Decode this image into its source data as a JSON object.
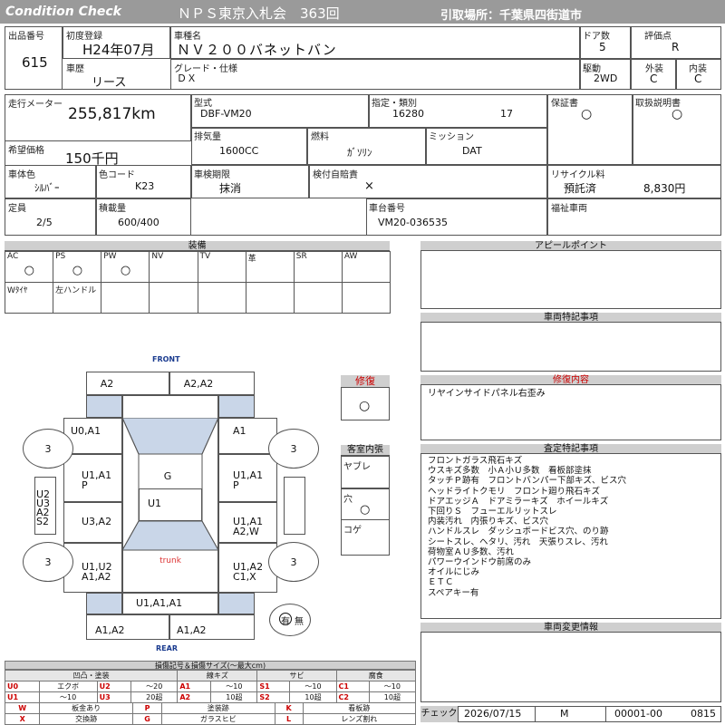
{
  "banner": {
    "title": "Condition Check",
    "auction": "ＮＰＳ東京入札会　363回",
    "pickup": "引取場所：千葉県四街道市"
  },
  "basic": {
    "lot_label": "出品番号",
    "lot": "615",
    "first_reg_label": "初度登録",
    "first_reg": "H24年07月",
    "name_label": "車種名",
    "name": "ＮＶ２００バネットバン",
    "door_label": "ドア数",
    "door": "5",
    "score_label": "評価点",
    "score": "R",
    "history_label": "車歴",
    "history": "リース",
    "grade_label": "グレード・仕様",
    "grade": "ＤＸ",
    "drive_label": "駆動",
    "drive": "2WD",
    "ext_label": "外装",
    "ext": "C",
    "int_label": "内装",
    "int": "C"
  },
  "spec": {
    "mileage_label": "走行メーター",
    "mileage": "255,817km",
    "model_label": "型式",
    "model": "DBF-VM20",
    "designation_label": "指定・類別",
    "designation": "16280",
    "category": "17",
    "warranty_label": "保証書",
    "warranty": "○",
    "manual_label": "取扱説明書",
    "manual": "○",
    "price_label": "希望価格",
    "price": "150千円",
    "displacement_label": "排気量",
    "displacement": "1600CC",
    "fuel_label": "燃料",
    "fuel": "ｶﾞｿﾘﾝ",
    "mission_label": "ミッション",
    "mission": "DAT",
    "color_label": "車体色",
    "color": "ｼﾙﾊﾞｰ",
    "color_code_label": "色コード",
    "color_code": "K23",
    "inspection_label": "車検期限",
    "inspection": "抹消",
    "insurance_label": "検付自賠責",
    "insurance": "×",
    "recycle_label": "リサイクル料",
    "recycle_status": "預託済",
    "recycle_fee": "8,830円",
    "capacity_label": "定員",
    "capacity": "2/5",
    "load_label": "積載量",
    "load": "600/400",
    "chassis_label": "車台番号",
    "chassis": "VM20-036535",
    "welfare_label": "福祉車両"
  },
  "equipment": {
    "title": "装備",
    "row1": [
      {
        "label": "AC",
        "mark": "○"
      },
      {
        "label": "PS",
        "mark": "○"
      },
      {
        "label": "PW",
        "mark": "○"
      },
      {
        "label": "NV",
        "mark": ""
      },
      {
        "label": "TV",
        "mark": ""
      },
      {
        "label": "革",
        "mark": ""
      },
      {
        "label": "SR",
        "mark": ""
      },
      {
        "label": "AW",
        "mark": ""
      }
    ],
    "row2": [
      {
        "label": "Wﾀｲﾔ"
      },
      {
        "label": "左ハンドル"
      },
      {
        "label": ""
      },
      {
        "label": ""
      },
      {
        "label": ""
      },
      {
        "label": ""
      },
      {
        "label": ""
      },
      {
        "label": ""
      }
    ]
  },
  "appeal": {
    "title": "アピールポイント"
  },
  "special": {
    "title": "車両特記事項"
  },
  "repair_box": {
    "title": "修復",
    "mark": "○"
  },
  "repair_content": {
    "title": "修復内容",
    "text": "リヤインサイドパネル右歪み"
  },
  "interior": {
    "title": "客室内張",
    "items": [
      {
        "label": "ヤブレ",
        "mark": ""
      },
      {
        "label": "穴",
        "mark": "○"
      },
      {
        "label": "コゲ",
        "mark": ""
      }
    ]
  },
  "inspector": {
    "title": "査定特記事項",
    "lines": [
      "フロントガラス飛石キズ",
      "ウスキズ多数　小Ａ小Ｕ多数　看板部塗抹",
      "タッチＰ跡有　フロントバンパー下部キズ、ビス穴",
      "ヘッドライトクモリ　フロント廻り飛石キズ",
      "ドアエッジＡ　ドアミラーキズ　ホイールキズ",
      "下回りＳ　フューエルリットスレ",
      "内装汚れ　内張りキズ、ビス穴",
      "ハンドルスレ　ダッシュボードビス穴、のり跡",
      "シートスレ、ヘタリ、汚れ　天張りスレ、汚れ",
      "荷物室ＡＵ多数、汚れ",
      "パワーウインドウ前席のみ",
      "オイルにじみ",
      "ＥＴＣ",
      "スペアキー有"
    ]
  },
  "changes": {
    "title": "車両変更情報"
  },
  "footer": {
    "check_label": "チェック",
    "date": "2026/07/15",
    "inspector_code": "M",
    "sheet_no": "00001-00",
    "lot": "0815"
  },
  "diagram": {
    "front": "FRONT",
    "rear": "REAR",
    "trunk": "trunk",
    "tire": "3",
    "cells": {
      "front_left": "A2",
      "front_right": "A2,A2",
      "hood": "G",
      "roof": "U1",
      "fl_fender": "U0,A1",
      "fr_fender": "A1",
      "fl_door": "U1,A1\nP",
      "fr_door": "U1,A1\nP",
      "rl_door": "U3,A2",
      "rr_door": "U1,A1\nA2,W",
      "rl_qtr": "U1,U2\nA1,A2",
      "rr_qtr": "U1,A2\nC1,X",
      "rear_panel": "U1,A1,A1",
      "bumper_l": "A1,A2",
      "bumper_r": "A1,A2",
      "left_side": "U2\nU3\nA2\nS2"
    },
    "spare_stamp": "有",
    "spare_none": "無"
  },
  "legend": {
    "title": "損傷記号＆損傷サイズ(～最大cm)",
    "groups": [
      "凹凸・塗装",
      "線キズ",
      "サビ",
      "腐食"
    ],
    "rows": [
      [
        {
          "c": "U0",
          "t": "エクボ"
        },
        {
          "c": "U2",
          "t": "～20"
        },
        {
          "c": "A1",
          "t": "～10"
        },
        {
          "c": "S1",
          "t": "～10"
        },
        {
          "c": "C1",
          "t": "～10"
        }
      ],
      [
        {
          "c": "U1",
          "t": "～10"
        },
        {
          "c": "U3",
          "t": "20超"
        },
        {
          "c": "A2",
          "t": "10超"
        },
        {
          "c": "S2",
          "t": "10超"
        },
        {
          "c": "C2",
          "t": "10超"
        }
      ]
    ],
    "misc": [
      [
        {
          "c": "W",
          "t": "板金あり"
        },
        {
          "c": "P",
          "t": "塗装跡"
        },
        {
          "c": "K",
          "t": "看板跡"
        }
      ],
      [
        {
          "c": "X",
          "t": "交換跡"
        },
        {
          "c": "G",
          "t": "ガラスヒビ"
        },
        {
          "c": "L",
          "t": "レンズ割れ"
        }
      ]
    ]
  }
}
